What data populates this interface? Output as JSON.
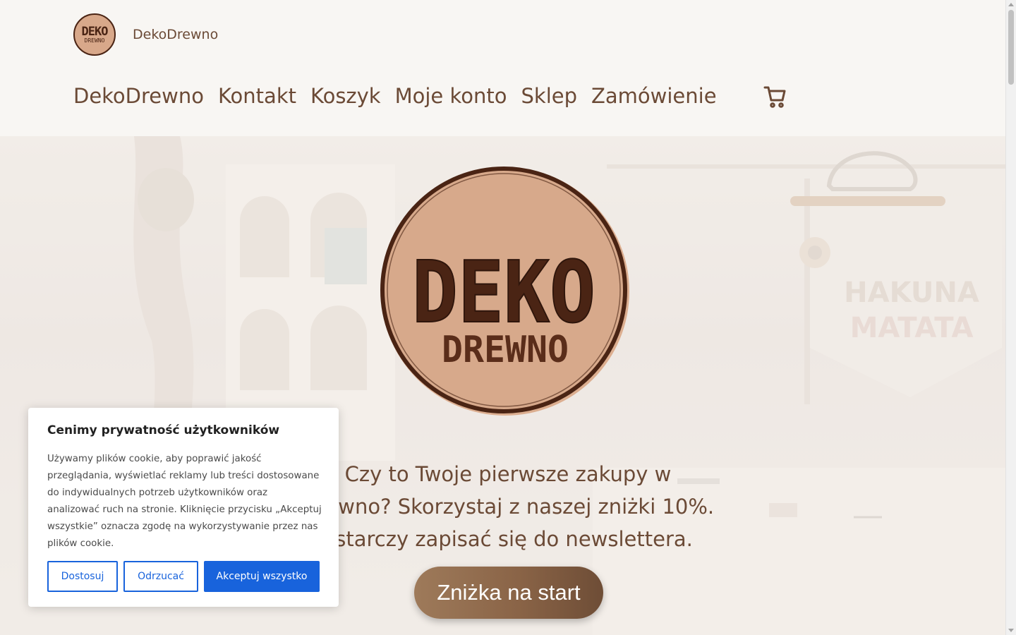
{
  "header": {
    "brand_name": "DekoDrewno",
    "logo_line1": "DEKO",
    "logo_line2": "DREWNO",
    "nav": [
      {
        "label": "DekoDrewno"
      },
      {
        "label": "Kontakt"
      },
      {
        "label": "Koszyk"
      },
      {
        "label": "Moje konto"
      },
      {
        "label": "Sklep"
      },
      {
        "label": "Zamówienie"
      }
    ],
    "cart_icon": "cart-icon"
  },
  "hero": {
    "logo_line1": "DEKO",
    "logo_line2": "DREWNO",
    "background_sign_line1": "HAKUNA",
    "background_sign_line2": "MATATA",
    "text_lines": [
      "Czy to Twoje pierwsze zakupy w",
      "Drewno? Skorzystaj z naszej zniżki 10%.",
      "ystarczy zapisać się do newslettera."
    ],
    "button_label": "Zniżka na start"
  },
  "cookie": {
    "title": "Cenimy prywatność użytkowników",
    "text": "Używamy plików cookie, aby poprawić jakość przeglądania, wyświetlać reklamy lub treści dostosowane do indywidualnych potrzeb użytkowników oraz analizować ruch na stronie. Kliknięcie przycisku „Akceptuj wszystkie” oznacza zgodę na wykorzystywanie przez nas plików cookie.",
    "customize_label": "Dostosuj",
    "reject_label": "Odrzucać",
    "accept_label": "Akceptuj wszystko"
  },
  "colors": {
    "brand_brown": "#6b4a36",
    "logo_fill": "#d8a88a",
    "logo_dark": "#4a2414",
    "cookie_accent": "#1863dc"
  }
}
